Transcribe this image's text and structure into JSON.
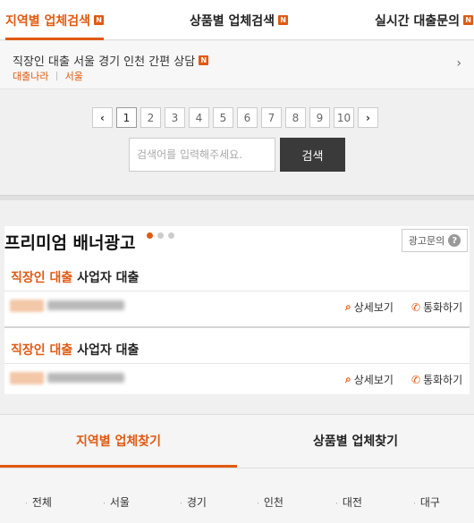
{
  "top_tabs": [
    {
      "label": "지역별 업체검색",
      "badge": "N"
    },
    {
      "label": "상품별 업체검색",
      "badge": "N"
    },
    {
      "label": "실시간 대출문의",
      "badge": "N"
    }
  ],
  "listing": {
    "title": "직장인 대출 서울 경기 인천 간편 상담",
    "badge": "N",
    "company": "대출나라",
    "region": "서울",
    "arrow": "›"
  },
  "pagination": {
    "prev": "‹",
    "next": "›",
    "pages": [
      "1",
      "2",
      "3",
      "4",
      "5",
      "6",
      "7",
      "8",
      "9",
      "10"
    ],
    "current": "1"
  },
  "search": {
    "placeholder": "검색어를 입력해주세요.",
    "button": "검색"
  },
  "premium": {
    "title": "프리미엄 배너광고",
    "inquiry": "광고문의",
    "inquiry_icon": "?",
    "ads": [
      {
        "highlight": "직장인 대출",
        "rest": " 사업자 대출",
        "detail": "상세보기",
        "call": "통화하기"
      },
      {
        "highlight": "직장인 대출",
        "rest": " 사업자 대출",
        "detail": "상세보기",
        "call": "통화하기"
      }
    ]
  },
  "bottom_tabs": [
    {
      "label": "지역별 업체찾기"
    },
    {
      "label": "상품별 업체찾기"
    }
  ],
  "regions": [
    "전체",
    "서울",
    "경기",
    "인천",
    "대전",
    "대구"
  ],
  "colors": {
    "accent": "#e05a12",
    "button_dark": "#3a3a3a"
  }
}
